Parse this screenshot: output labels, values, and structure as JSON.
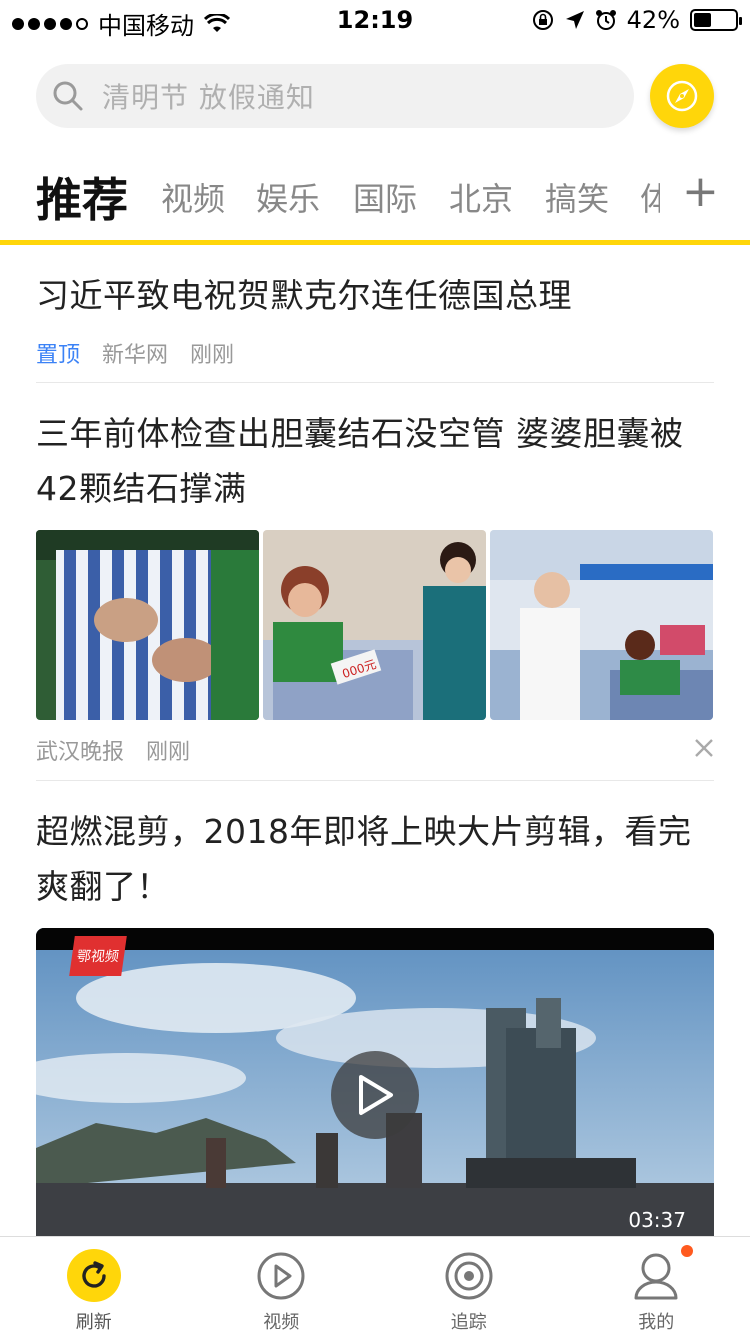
{
  "status_bar": {
    "carrier": "中国移动",
    "time": "12:19",
    "battery_text": "42%",
    "battery_level": 0.42
  },
  "search": {
    "placeholder": "清明节 放假通知",
    "icon": "search-icon",
    "compass_icon": "compass-icon"
  },
  "tabs": {
    "items": [
      "推荐",
      "视频",
      "娱乐",
      "国际",
      "北京",
      "搞笑"
    ],
    "clipped_item": "体",
    "active_index": 0,
    "add_label": "+"
  },
  "feed": {
    "items": [
      {
        "title": "习近平致电祝贺默克尔连任德国总理",
        "pin_label": "置顶",
        "source": "新华网",
        "time": "刚刚"
      },
      {
        "title": "三年前体检查出胆囊结石没空管  婆婆胆囊被42颗结石撑满",
        "source": "武汉晚报",
        "time": "刚刚",
        "image_caption": "000元"
      },
      {
        "title": "超燃混剪，2018年即将上映大片剪辑，看完爽翻了！",
        "duration": "03:37",
        "logo_text": "鄂视频"
      }
    ]
  },
  "bottom_nav": {
    "items": [
      {
        "label": "刷新",
        "icon": "refresh-icon"
      },
      {
        "label": "视频",
        "icon": "play-circle-icon"
      },
      {
        "label": "追踪",
        "icon": "target-icon"
      },
      {
        "label": "我的",
        "icon": "user-icon"
      }
    ],
    "active_index": 0
  },
  "colors": {
    "accent": "#ffd60a",
    "pin": "#3b82f6",
    "badge": "#ff5a1f"
  }
}
